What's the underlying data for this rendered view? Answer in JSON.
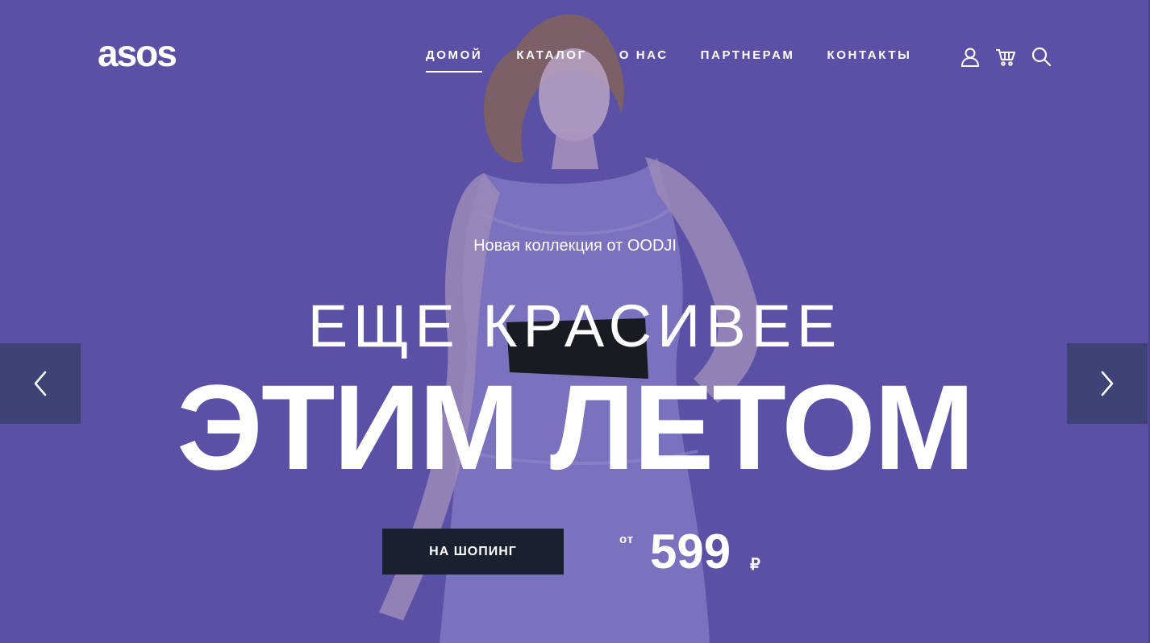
{
  "brand": {
    "logo_text": "asos"
  },
  "nav": {
    "items": [
      {
        "label": "ДОМОЙ",
        "active": true
      },
      {
        "label": "КАТАЛОГ",
        "active": false
      },
      {
        "label": "О НАС",
        "active": false
      },
      {
        "label": "ПАРТНЕРАМ",
        "active": false
      },
      {
        "label": "КОНТАКТЫ",
        "active": false
      }
    ]
  },
  "header_icons": [
    "user-icon",
    "cart-icon",
    "search-icon"
  ],
  "hero": {
    "subtitle": "Новая коллекция от OODJI",
    "headline_line1": "ЕЩЕ КРАСИВЕЕ",
    "headline_line2": "ЭТИМ ЛЕТОМ",
    "cta_label": "НА ШОПИНГ",
    "price_prefix": "от",
    "price_value": "599",
    "price_currency": "₽"
  },
  "slider": {
    "prev_icon": "chevron-left-icon",
    "next_icon": "chevron-right-icon"
  },
  "colors": {
    "overlay": "#5a51a6",
    "button_bg": "#1b2030",
    "arrow_bg": "#3f4275",
    "text": "#ffffff"
  }
}
